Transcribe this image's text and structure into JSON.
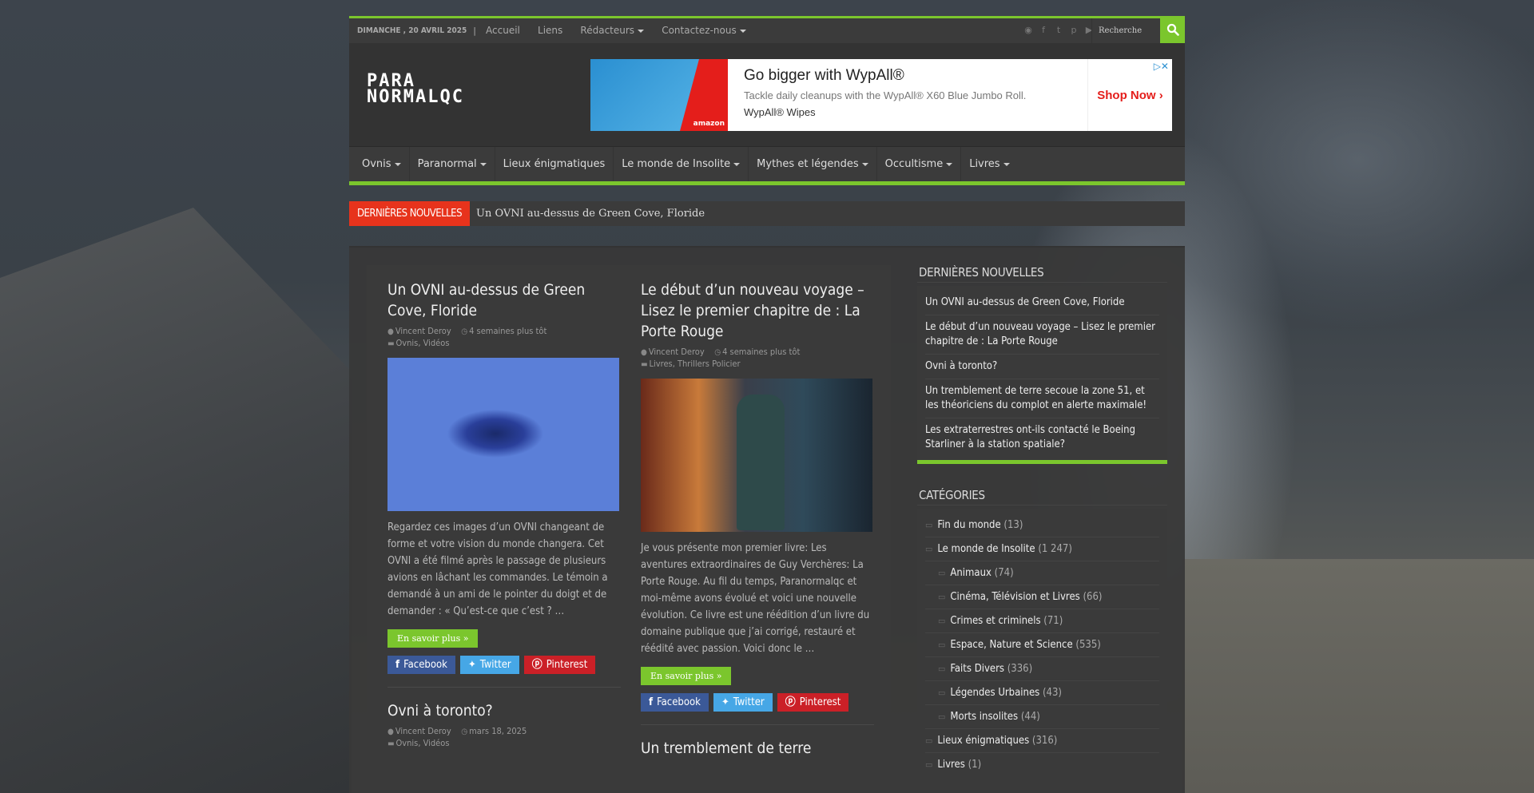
{
  "topbar": {
    "date": "DIMANCHE , 20 AVRIL 2025",
    "sep": "|",
    "links": [
      "Accueil",
      "Liens",
      "Rédacteurs",
      "Contactez-nous"
    ],
    "search_placeholder": "Recherche"
  },
  "header": {
    "logo_line1": "PARA",
    "logo_line2": "NORMALQC",
    "ad": {
      "headline": "Go bigger with WypAll®",
      "description": "Tackle daily cleanups with the WypAll® X60 Blue Jumbo Roll.",
      "brand": "WypAll® Wipes",
      "cta": "Shop Now",
      "img_badge": "amazon"
    }
  },
  "mainnav": [
    "Ovnis",
    "Paranormal",
    "Lieux énigmatiques",
    "Le monde de Insolite",
    "Mythes et légendes",
    "Occultisme",
    "Livres"
  ],
  "breaking": {
    "label": "DERNIÈRES NOUVELLES",
    "text": "Un OVNI au-dessus de Green Cove, Floride"
  },
  "posts": [
    {
      "title": "Un OVNI au-dessus de Green Cove, Floride",
      "author": "Vincent Deroy",
      "time": "4 semaines plus tôt",
      "cats": "Ovnis, Vidéos",
      "excerpt": "Regardez ces images d’un OVNI changeant de forme et votre vision du monde changera. Cet OVNI a été filmé après le passage de plusieurs avions en lâchant les commandes. Le témoin a demandé à un ami de le pointer du doigt et de demander : « Qu’est-ce que c’est ? …",
      "more": "En savoir plus »"
    },
    {
      "title": "Le début d’un nouveau voyage – Lisez le premier chapitre de : La Porte Rouge",
      "author": "Vincent Deroy",
      "time": "4 semaines plus tôt",
      "cats": "Livres, Thrillers Policier",
      "excerpt": "Je vous présente mon premier livre: Les aventures extraordinaires de Guy Verchères: La Porte Rouge. Au fil du temps, Paranormalqc et moi-même avons évolué et voici une nouvelle évolution. Ce livre est une réédition d’un livre du domaine publique que j’ai corrigé, restauré et réédité avec passion. Voici donc le …",
      "more": "En savoir plus »"
    },
    {
      "title": "Ovni à toronto?",
      "author": "Vincent Deroy",
      "time": "mars 18, 2025",
      "cats": "Ovnis, Vidéos"
    },
    {
      "title": "Un tremblement de terre"
    }
  ],
  "share": {
    "facebook": "Facebook",
    "twitter": "Twitter",
    "pinterest": "Pinterest"
  },
  "sidebar": {
    "recent_title": "DERNIÈRES NOUVELLES",
    "recent": [
      "Un OVNI au-dessus de Green Cove, Floride",
      "Le début d’un nouveau voyage – Lisez le premier chapitre de : La Porte Rouge",
      "Ovni à toronto?",
      "Un tremblement de terre secoue la zone 51, et les théoriciens du complot en alerte maximale!",
      "Les extraterrestres ont-ils contacté le Boeing Starliner à la station spatiale?"
    ],
    "cats_title": "CATÉGORIES",
    "cats": [
      {
        "name": "Fin du monde",
        "count": "(13)",
        "sub": false
      },
      {
        "name": "Le monde de Insolite",
        "count": "(1 247)",
        "sub": false
      },
      {
        "name": "Animaux",
        "count": "(74)",
        "sub": true
      },
      {
        "name": "Cinéma, Télévision et Livres",
        "count": "(66)",
        "sub": true
      },
      {
        "name": "Crimes et criminels",
        "count": "(71)",
        "sub": true
      },
      {
        "name": "Espace, Nature et Science",
        "count": "(535)",
        "sub": true
      },
      {
        "name": "Faits Divers",
        "count": "(336)",
        "sub": true
      },
      {
        "name": "Légendes Urbaines",
        "count": "(43)",
        "sub": true
      },
      {
        "name": "Morts insolites",
        "count": "(44)",
        "sub": true
      },
      {
        "name": "Lieux énigmatiques",
        "count": "(316)",
        "sub": false
      },
      {
        "name": "Livres",
        "count": "(1)",
        "sub": false
      }
    ]
  },
  "colors": {
    "accent": "#7bc62d",
    "breaking": "#e7331c",
    "facebook": "#3b5998",
    "twitter": "#46a7e6",
    "pinterest": "#cb2027"
  }
}
